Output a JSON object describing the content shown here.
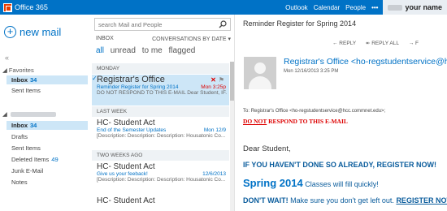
{
  "topbar": {
    "brand": "Office 365",
    "nav": [
      "Outlook",
      "Calendar",
      "People"
    ],
    "more": "•••",
    "user": "your name"
  },
  "folders": {
    "new_mail": "new mail",
    "collapse": "«",
    "favorites": "Favorites",
    "fav_items": [
      {
        "label": "Inbox",
        "count": "34"
      },
      {
        "label": "Sent Items",
        "count": ""
      }
    ],
    "account_items": [
      {
        "label": "Inbox",
        "count": "34"
      },
      {
        "label": "Drafts",
        "count": ""
      },
      {
        "label": "Sent Items",
        "count": ""
      },
      {
        "label": "Deleted Items",
        "count": "49"
      },
      {
        "label": "Junk E-Mail",
        "count": ""
      },
      {
        "label": "Notes",
        "count": ""
      }
    ]
  },
  "list": {
    "search_placeholder": "search Mail and People",
    "folder_title": "INBOX",
    "sort_label": "CONVERSATIONS BY DATE ▾",
    "filters": [
      "all",
      "unread",
      "to me",
      "flagged"
    ],
    "groups": [
      "MONDAY",
      "LAST WEEK",
      "TWO WEEKS AGO"
    ],
    "messages": [
      {
        "sender": "Registrar's Office",
        "subject": "Reminder Register for Spring 2014",
        "date": "Mon 3:25p",
        "preview": "DO NOT RESPOND TO THIS E-MAIL Dear Student, IF..."
      },
      {
        "sender": "HC- Student Act",
        "subject": "End of the Semester Updates",
        "date": "Mon 12/9",
        "preview": "[Description: Description: Description: Housatonic Co..."
      },
      {
        "sender": "HC- Student Act",
        "subject": "Give us your feeback!",
        "date": "12/6/2013",
        "preview": "[Description: Description: Description: Housatonic Co..."
      },
      {
        "sender": "HC- Student Act",
        "subject": "",
        "date": "",
        "preview": ""
      }
    ]
  },
  "reading": {
    "subject": "Reminder Register for Spring 2014",
    "actions": [
      "← REPLY",
      "↞ REPLY ALL",
      "→ F"
    ],
    "from": "Registrar's Office <ho-regstudentservice@hcc.commnet.edu>",
    "date": "Mon 12/16/2013 3:25 PM",
    "to_label": "To:",
    "to_value": "Registrar's Office <ho-regstudentservice@hcc.commnet.edu>;",
    "warn_u": "DO NOT",
    "warn_rest": " RESPOND TO THIS E-MAIL",
    "greeting": "Dear Student,",
    "line1": "IF YOU HAVEN'T DONE SO ALREADY, REGISTER NOW!",
    "line2_big": "Spring 2014",
    "line2_small": " Classes will fill quickly!",
    "line3_bold": "DON'T WAIT!",
    "line3_mid": " Make sure you don't get left out. ",
    "line3_ul": "REGISTER NOW!"
  },
  "colors": {
    "brand_blue": "#0072c6",
    "selected_bg": "#cde6f7",
    "warning_red": "#dd0000"
  }
}
